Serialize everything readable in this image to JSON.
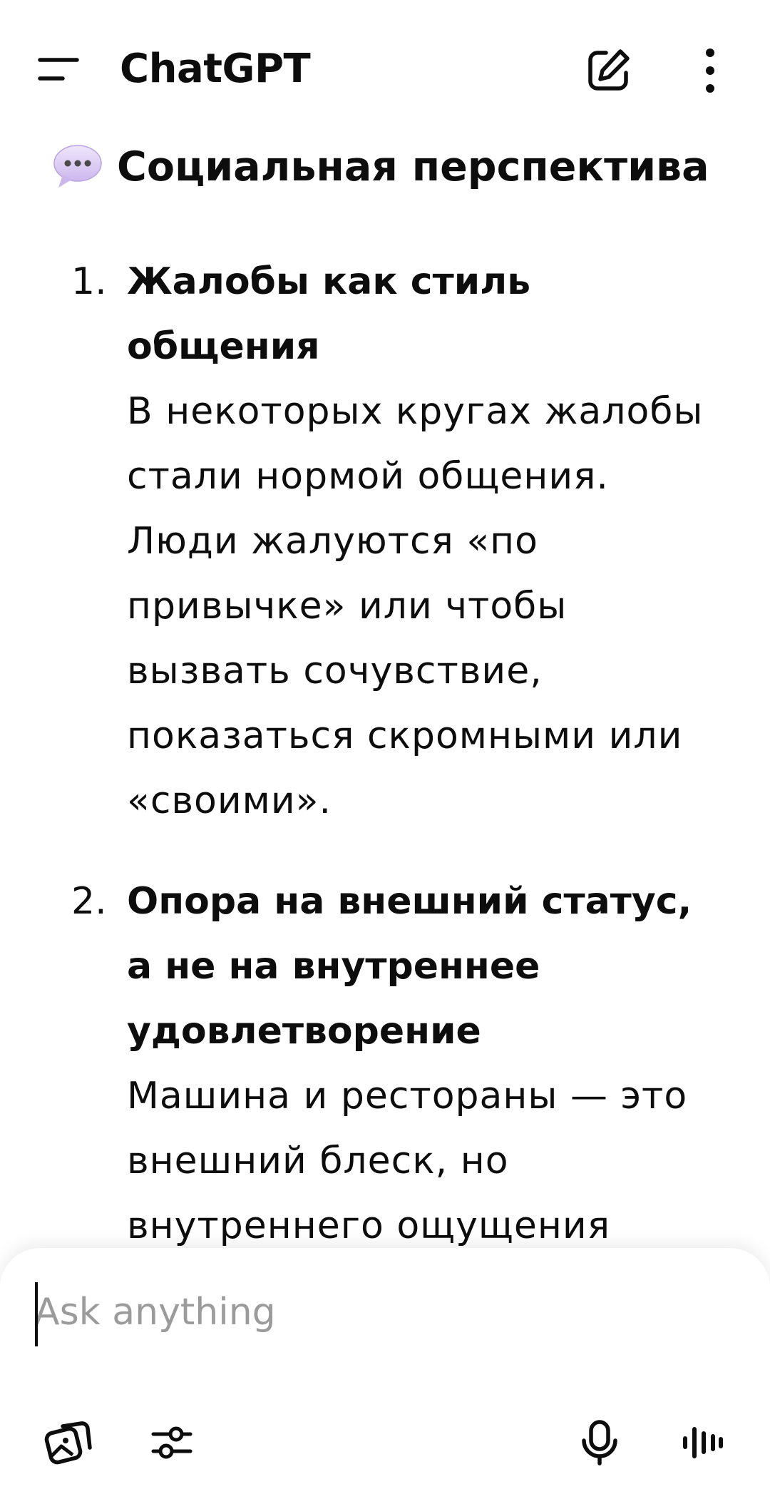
{
  "header": {
    "title": "ChatGPT",
    "menu_icon": "hamburger-menu-icon",
    "new_chat_icon": "edit-pencil-icon",
    "more_icon": "vertical-ellipsis-icon"
  },
  "content": {
    "heading_icon": "speech-bubble-icon",
    "heading": "Социальная перспектива",
    "items": [
      {
        "number": "1.",
        "title": "Жалобы как стиль общения",
        "text": "В некоторых кругах жалобы стали нормой общения. Люди жалуются «по привычке» или чтобы вызвать сочувствие, показаться скромными или «своими»."
      },
      {
        "number": "2.",
        "title": "Опора на внешний статус, а не на внутреннее удовлетворение",
        "text": "Машина и рестораны — это внешний блеск, но внутреннего ощущения счастья может не быть."
      }
    ]
  },
  "composer": {
    "value": "",
    "placeholder": "Ask anything",
    "attach_icon": "image-gallery-icon",
    "tools_icon": "sliders-icon",
    "mic_icon": "microphone-icon",
    "voice_icon": "voice-waveform-icon"
  },
  "colors": {
    "text": "#0d0d0d",
    "placeholder": "#9b9b9b",
    "bubble": "#d9c9f2",
    "background": "#ffffff"
  }
}
